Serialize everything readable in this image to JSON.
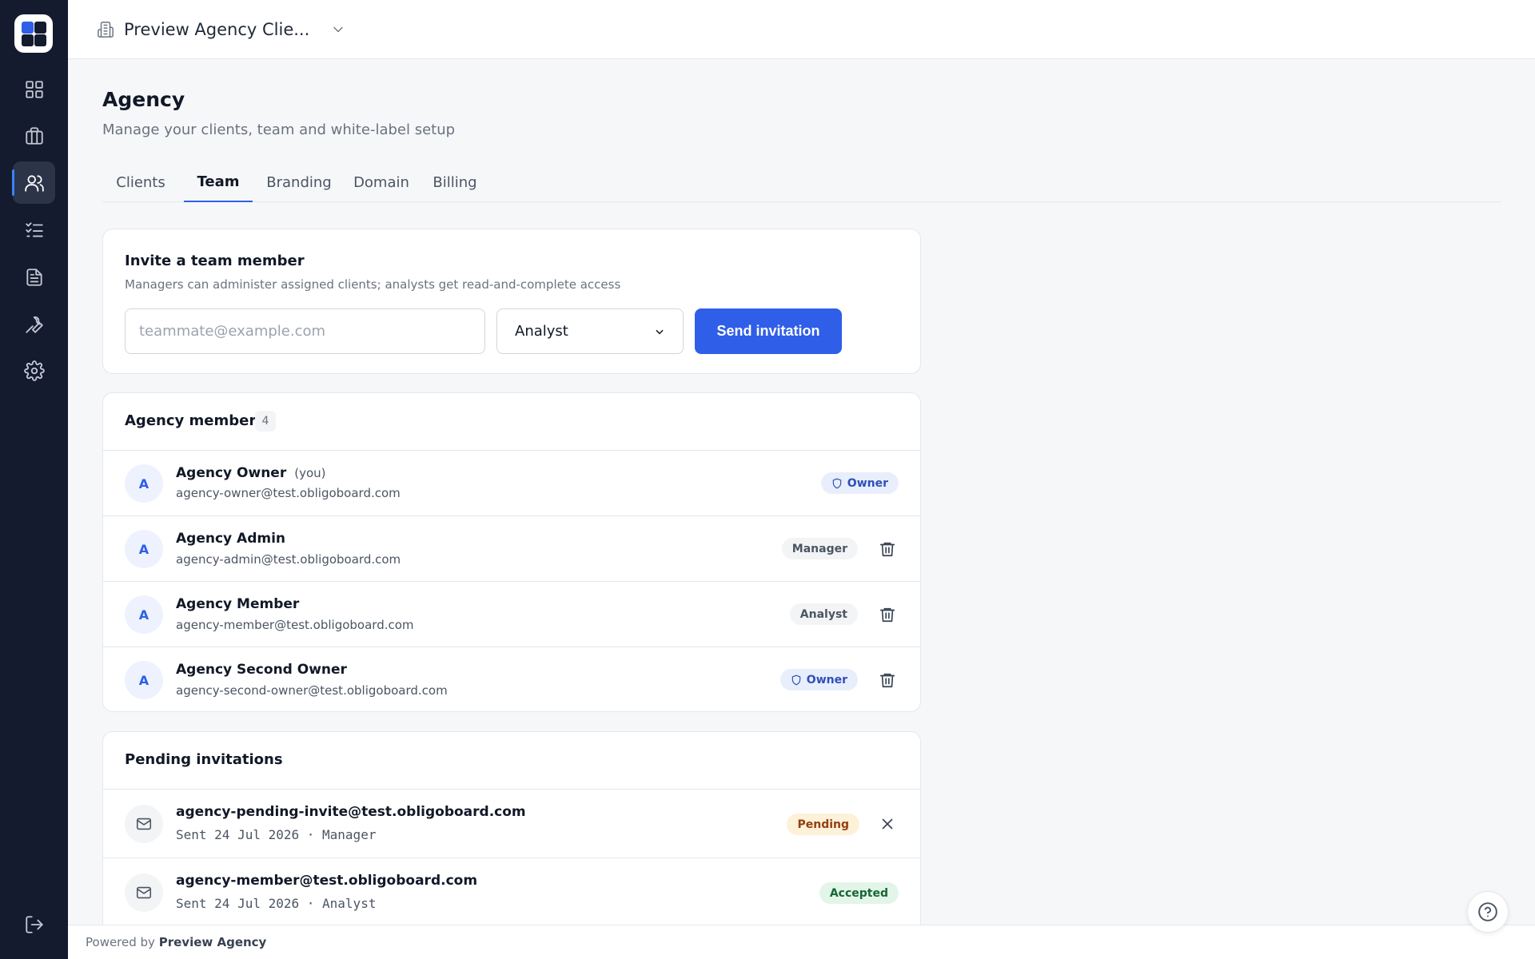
{
  "topbar": {
    "workspace_name": "Preview Agency Clie...",
    "workspace_icon": "building-icon",
    "chevron_icon": "chevron-down-icon"
  },
  "sidebar": {
    "items": [
      {
        "name": "dashboard",
        "icon": "grid-icon",
        "active": false
      },
      {
        "name": "clients",
        "icon": "briefcase-icon",
        "active": false
      },
      {
        "name": "agency",
        "icon": "users-icon",
        "active": true
      },
      {
        "name": "tasks",
        "icon": "checklist-icon",
        "active": false
      },
      {
        "name": "documents",
        "icon": "document-icon",
        "active": false
      },
      {
        "name": "tools",
        "icon": "wrench-icon",
        "active": false
      },
      {
        "name": "settings",
        "icon": "gear-icon",
        "active": false
      }
    ],
    "logout_icon": "logout-icon"
  },
  "page": {
    "title": "Agency",
    "subtitle": "Manage your clients, team and white-label setup"
  },
  "tabs": [
    {
      "label": "Clients",
      "active": false
    },
    {
      "label": "Team",
      "active": true
    },
    {
      "label": "Branding",
      "active": false
    },
    {
      "label": "Domain",
      "active": false
    },
    {
      "label": "Billing",
      "active": false
    }
  ],
  "invite": {
    "title": "Invite a team member",
    "description": "Managers can administer assigned clients; analysts get read-and-complete access",
    "email_placeholder": "teammate@example.com",
    "email_value": "",
    "role_selected": "Analyst",
    "send_label": "Send invitation"
  },
  "members": {
    "title": "Agency members",
    "count": "4",
    "rows": [
      {
        "initial": "A",
        "name": "Agency Owner",
        "you": "(you)",
        "email": "agency-owner@test.obligoboard.com",
        "role": "Owner"
      },
      {
        "initial": "A",
        "name": "Agency Admin",
        "email": "agency-admin@test.obligoboard.com",
        "role": "Manager"
      },
      {
        "initial": "A",
        "name": "Agency Member",
        "email": "agency-member@test.obligoboard.com",
        "role": "Analyst"
      },
      {
        "initial": "A",
        "name": "Agency Second Owner",
        "email": "agency-second-owner@test.obligoboard.com",
        "role": "Owner"
      }
    ]
  },
  "pending": {
    "title": "Pending invitations",
    "rows": [
      {
        "email": "agency-pending-invite@test.obligoboard.com",
        "meta": "Sent 24 Jul 2026 · Manager",
        "status": "Pending"
      },
      {
        "email": "agency-member@test.obligoboard.com",
        "meta": "Sent 24 Jul 2026 · Analyst",
        "status": "Accepted"
      }
    ]
  },
  "footer": {
    "prefix": "Powered by",
    "brand": "Preview Agency"
  },
  "colors": {
    "accent": "#2f5ee8",
    "sidebar_bg": "#141b2e",
    "pending": "#fdf1d9",
    "accepted": "#e3f5e8"
  }
}
